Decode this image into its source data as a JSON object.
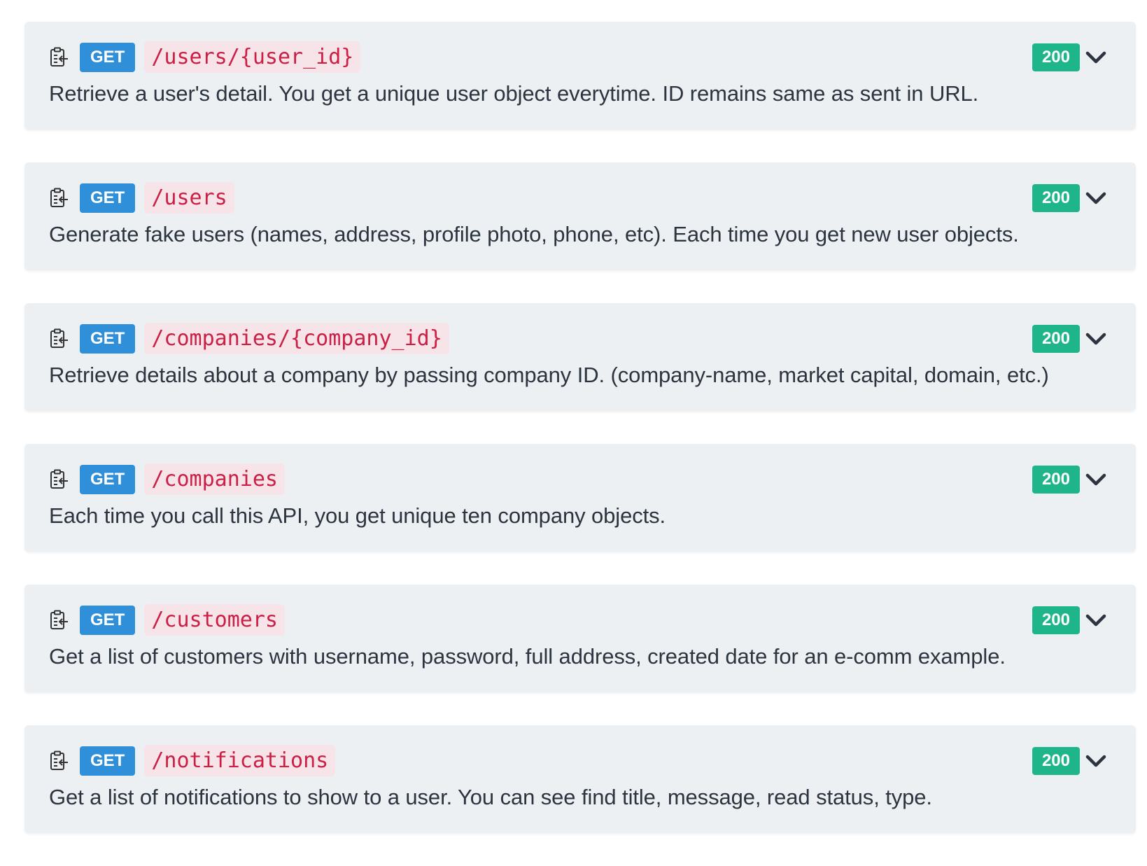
{
  "endpoints": [
    {
      "method": "GET",
      "path": "/users/{user_id}",
      "status": "200",
      "description": "Retrieve a user's detail. You get a unique user object everytime. ID remains same as sent in URL."
    },
    {
      "method": "GET",
      "path": "/users",
      "status": "200",
      "description": "Generate fake users (names, address, profile photo, phone, etc). Each time you get new user objects."
    },
    {
      "method": "GET",
      "path": "/companies/{company_id}",
      "status": "200",
      "description": "Retrieve details about a company by passing company ID. (company-name, market capital, domain, etc.)"
    },
    {
      "method": "GET",
      "path": "/companies",
      "status": "200",
      "description": "Each time you call this API, you get unique ten company objects."
    },
    {
      "method": "GET",
      "path": "/customers",
      "status": "200",
      "description": "Get a list of customers with username, password, full address, created date for an e-comm example."
    },
    {
      "method": "GET",
      "path": "/notifications",
      "status": "200",
      "description": "Get a list of notifications to show to a user. You can see find title, message, read status, type."
    }
  ],
  "icons": {
    "copy": "copy-to-clipboard-icon",
    "expand": "chevron-down-icon"
  },
  "colors": {
    "method_get": "#2f8fd8",
    "status_ok": "#1fb58a",
    "path_text": "#cc1f45",
    "card_bg": "#edf0f2"
  }
}
